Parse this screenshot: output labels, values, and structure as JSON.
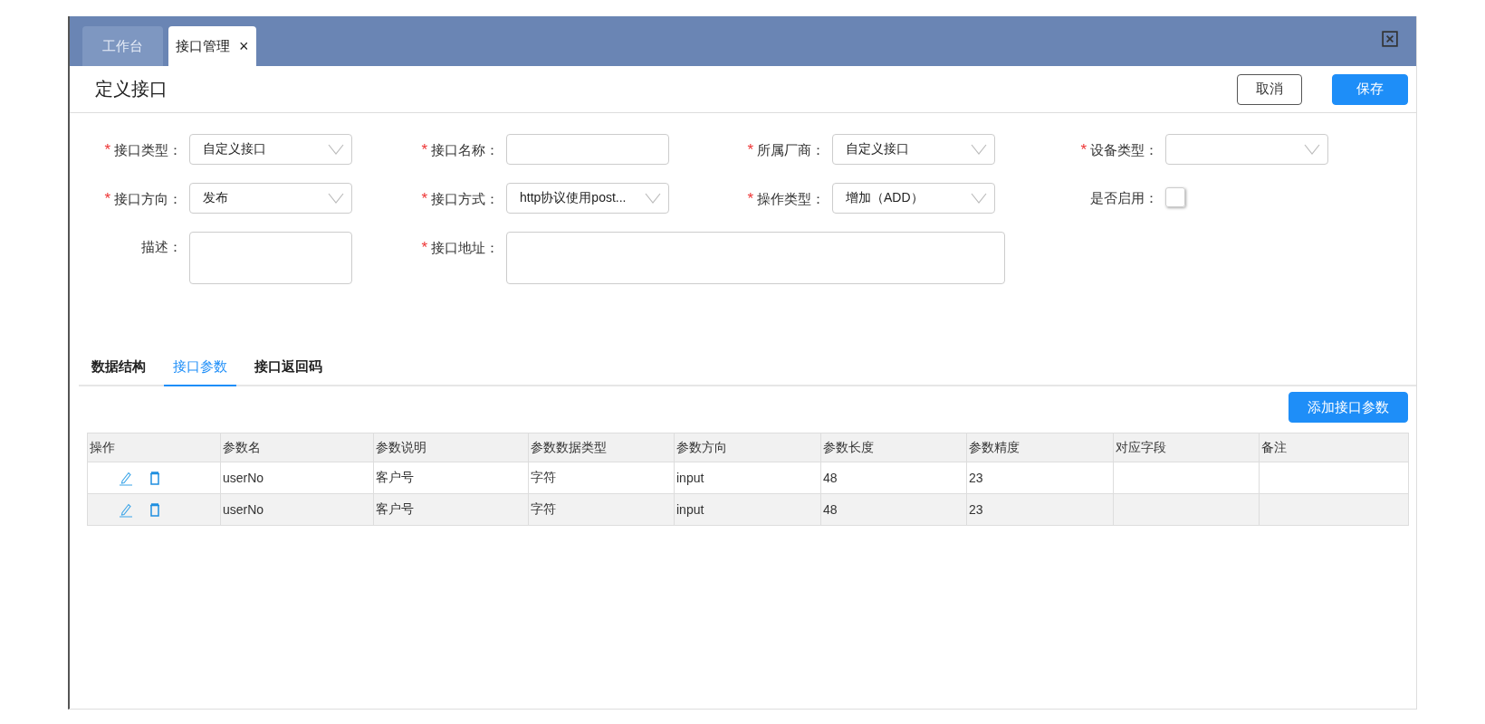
{
  "tabs": [
    {
      "label": "工作台",
      "selected": false
    },
    {
      "label": "接口管理",
      "selected": true,
      "close": "×"
    }
  ],
  "header": {
    "title": "定义接口",
    "buttons": [
      {
        "label": "取消",
        "kind": "secondary"
      },
      {
        "label": "保存",
        "kind": "primary"
      }
    ]
  },
  "form": {
    "fields": [
      {
        "mark": "*",
        "label": "接口类型：",
        "kind": "select",
        "value": "自定义接口"
      },
      {
        "mark": "*",
        "label": "接口名称：",
        "kind": "input"
      },
      {
        "mark": "*",
        "label": "所属厂商：",
        "kind": "select",
        "value": "自定义接口"
      },
      {
        "mark": "*",
        "label": "设备类型：",
        "kind": "select"
      },
      {
        "mark": "*",
        "label": "接口方向：",
        "kind": "select",
        "value": "发布"
      },
      {
        "mark": "*",
        "label": "接口方式：",
        "kind": "select",
        "value": "http协议使用post..."
      },
      {
        "mark": "*",
        "label": "操作类型：",
        "kind": "select",
        "value": "增加（ADD）"
      },
      {
        "label": "是否启用：",
        "kind": "checkbox",
        "checked": false
      },
      {
        "label": "描述：",
        "kind": "textarea"
      },
      {
        "mark": "*",
        "label": "接口地址：",
        "kind": "textarea-wide"
      }
    ]
  },
  "sub_tabs": [
    {
      "label": "数据结构",
      "selected": false
    },
    {
      "label": "接口参数",
      "selected": true
    },
    {
      "label": "接口返回码",
      "selected": false
    }
  ],
  "add_button": "添加接口参数",
  "table": {
    "columns": [
      "操作",
      "参数名",
      "参数说明",
      "参数数据类型",
      "参数方向",
      "参数长度",
      "参数精度",
      "对应字段",
      "备注"
    ],
    "rows": [
      {
        "cells": [
          "",
          "userNo",
          "客户号",
          "字符",
          "input",
          "48",
          "23"
        ]
      },
      {
        "cells": [
          "",
          "userNo",
          "客户号",
          "字符",
          "input",
          "48",
          "23"
        ]
      }
    ]
  }
}
